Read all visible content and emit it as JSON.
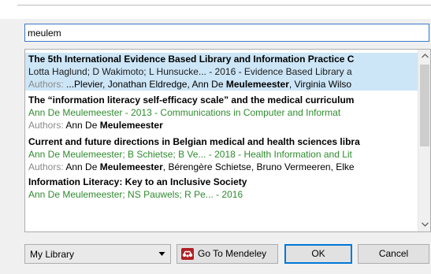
{
  "search": {
    "value": "meulem"
  },
  "results": [
    {
      "title": "The 5th International Evidence Based Library and Information Practice C",
      "meta": "Lotta Haglund; D Wakimoto; L Hunsucke... - 2016 - Evidence Based Library a",
      "authors_label": "Authors:",
      "authors_pre": " ...Plevier, Jonathan Eldredge, Ann De ",
      "authors_bold": "Meulemeester",
      "authors_post": ", Virginia Wilso"
    },
    {
      "title": "The “information literacy self-efficacy scale” and the medical curriculum",
      "meta": "Ann De Meulemeester - 2013 - Communications in Computer and Informat",
      "authors_label": "Authors:",
      "authors_pre": " Ann De ",
      "authors_bold": "Meulemeester",
      "authors_post": ""
    },
    {
      "title": "Current and future directions in Belgian medical and health sciences libra",
      "meta": "Ann De Meulemeester; B Schietse; B Ve... - 2018 - Health Information and Lit",
      "authors_label": "Authors:",
      "authors_pre": " Ann De ",
      "authors_bold": "Meulemeester",
      "authors_post": ", Bérengère Schietse, Bruno Vermeeren, Elke"
    },
    {
      "title": "Information Literacy: Key to an Inclusive Society",
      "meta": "Ann De Meulemeester; NS Pauwels; R Pe... - 2016"
    }
  ],
  "library_select": {
    "value": "My Library"
  },
  "buttons": {
    "mendeley": "Go To Mendeley",
    "ok": "OK",
    "cancel": "Cancel"
  },
  "icons": {
    "scroll_up": "chevron-up-icon",
    "scroll_down": "chevron-down-icon",
    "dropdown": "triangle-down-icon",
    "mendeley": "mendeley-logo-icon"
  },
  "colors": {
    "selection": "#cde6f7",
    "meta_green": "#2e8b2e",
    "authors_label": "#8a8a8a",
    "focus_blue": "#0078d7",
    "mendeley_red": "#b01e23"
  }
}
